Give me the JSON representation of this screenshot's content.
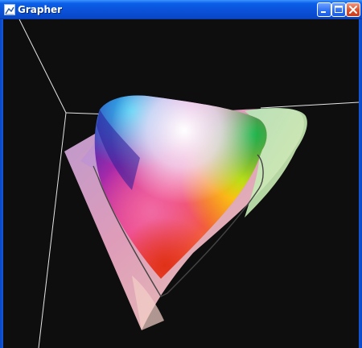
{
  "window": {
    "title": "Grapher",
    "app_icon": "grapher-app-icon",
    "controls": {
      "minimize_icon": "minimize-icon",
      "maximize_icon": "maximize-icon",
      "close_icon": "close-icon"
    },
    "colors": {
      "titlebar": "#0a52d9",
      "close_button": "#dc4d2a",
      "background": "#0e0e0e",
      "axis_lines": "#e6e6e6"
    }
  }
}
